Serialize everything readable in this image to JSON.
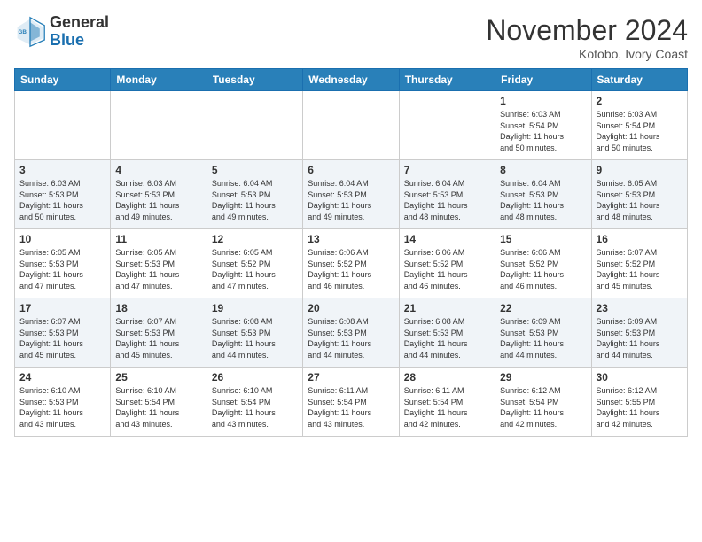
{
  "header": {
    "logo_general": "General",
    "logo_blue": "Blue",
    "month_title": "November 2024",
    "location": "Kotobo, Ivory Coast"
  },
  "days_of_week": [
    "Sunday",
    "Monday",
    "Tuesday",
    "Wednesday",
    "Thursday",
    "Friday",
    "Saturday"
  ],
  "weeks": [
    {
      "days": [
        {
          "num": "",
          "info": ""
        },
        {
          "num": "",
          "info": ""
        },
        {
          "num": "",
          "info": ""
        },
        {
          "num": "",
          "info": ""
        },
        {
          "num": "",
          "info": ""
        },
        {
          "num": "1",
          "info": "Sunrise: 6:03 AM\nSunset: 5:54 PM\nDaylight: 11 hours\nand 50 minutes."
        },
        {
          "num": "2",
          "info": "Sunrise: 6:03 AM\nSunset: 5:54 PM\nDaylight: 11 hours\nand 50 minutes."
        }
      ]
    },
    {
      "days": [
        {
          "num": "3",
          "info": "Sunrise: 6:03 AM\nSunset: 5:53 PM\nDaylight: 11 hours\nand 50 minutes."
        },
        {
          "num": "4",
          "info": "Sunrise: 6:03 AM\nSunset: 5:53 PM\nDaylight: 11 hours\nand 49 minutes."
        },
        {
          "num": "5",
          "info": "Sunrise: 6:04 AM\nSunset: 5:53 PM\nDaylight: 11 hours\nand 49 minutes."
        },
        {
          "num": "6",
          "info": "Sunrise: 6:04 AM\nSunset: 5:53 PM\nDaylight: 11 hours\nand 49 minutes."
        },
        {
          "num": "7",
          "info": "Sunrise: 6:04 AM\nSunset: 5:53 PM\nDaylight: 11 hours\nand 48 minutes."
        },
        {
          "num": "8",
          "info": "Sunrise: 6:04 AM\nSunset: 5:53 PM\nDaylight: 11 hours\nand 48 minutes."
        },
        {
          "num": "9",
          "info": "Sunrise: 6:05 AM\nSunset: 5:53 PM\nDaylight: 11 hours\nand 48 minutes."
        }
      ]
    },
    {
      "days": [
        {
          "num": "10",
          "info": "Sunrise: 6:05 AM\nSunset: 5:53 PM\nDaylight: 11 hours\nand 47 minutes."
        },
        {
          "num": "11",
          "info": "Sunrise: 6:05 AM\nSunset: 5:53 PM\nDaylight: 11 hours\nand 47 minutes."
        },
        {
          "num": "12",
          "info": "Sunrise: 6:05 AM\nSunset: 5:52 PM\nDaylight: 11 hours\nand 47 minutes."
        },
        {
          "num": "13",
          "info": "Sunrise: 6:06 AM\nSunset: 5:52 PM\nDaylight: 11 hours\nand 46 minutes."
        },
        {
          "num": "14",
          "info": "Sunrise: 6:06 AM\nSunset: 5:52 PM\nDaylight: 11 hours\nand 46 minutes."
        },
        {
          "num": "15",
          "info": "Sunrise: 6:06 AM\nSunset: 5:52 PM\nDaylight: 11 hours\nand 46 minutes."
        },
        {
          "num": "16",
          "info": "Sunrise: 6:07 AM\nSunset: 5:52 PM\nDaylight: 11 hours\nand 45 minutes."
        }
      ]
    },
    {
      "days": [
        {
          "num": "17",
          "info": "Sunrise: 6:07 AM\nSunset: 5:53 PM\nDaylight: 11 hours\nand 45 minutes."
        },
        {
          "num": "18",
          "info": "Sunrise: 6:07 AM\nSunset: 5:53 PM\nDaylight: 11 hours\nand 45 minutes."
        },
        {
          "num": "19",
          "info": "Sunrise: 6:08 AM\nSunset: 5:53 PM\nDaylight: 11 hours\nand 44 minutes."
        },
        {
          "num": "20",
          "info": "Sunrise: 6:08 AM\nSunset: 5:53 PM\nDaylight: 11 hours\nand 44 minutes."
        },
        {
          "num": "21",
          "info": "Sunrise: 6:08 AM\nSunset: 5:53 PM\nDaylight: 11 hours\nand 44 minutes."
        },
        {
          "num": "22",
          "info": "Sunrise: 6:09 AM\nSunset: 5:53 PM\nDaylight: 11 hours\nand 44 minutes."
        },
        {
          "num": "23",
          "info": "Sunrise: 6:09 AM\nSunset: 5:53 PM\nDaylight: 11 hours\nand 44 minutes."
        }
      ]
    },
    {
      "days": [
        {
          "num": "24",
          "info": "Sunrise: 6:10 AM\nSunset: 5:53 PM\nDaylight: 11 hours\nand 43 minutes."
        },
        {
          "num": "25",
          "info": "Sunrise: 6:10 AM\nSunset: 5:54 PM\nDaylight: 11 hours\nand 43 minutes."
        },
        {
          "num": "26",
          "info": "Sunrise: 6:10 AM\nSunset: 5:54 PM\nDaylight: 11 hours\nand 43 minutes."
        },
        {
          "num": "27",
          "info": "Sunrise: 6:11 AM\nSunset: 5:54 PM\nDaylight: 11 hours\nand 43 minutes."
        },
        {
          "num": "28",
          "info": "Sunrise: 6:11 AM\nSunset: 5:54 PM\nDaylight: 11 hours\nand 42 minutes."
        },
        {
          "num": "29",
          "info": "Sunrise: 6:12 AM\nSunset: 5:54 PM\nDaylight: 11 hours\nand 42 minutes."
        },
        {
          "num": "30",
          "info": "Sunrise: 6:12 AM\nSunset: 5:55 PM\nDaylight: 11 hours\nand 42 minutes."
        }
      ]
    }
  ]
}
